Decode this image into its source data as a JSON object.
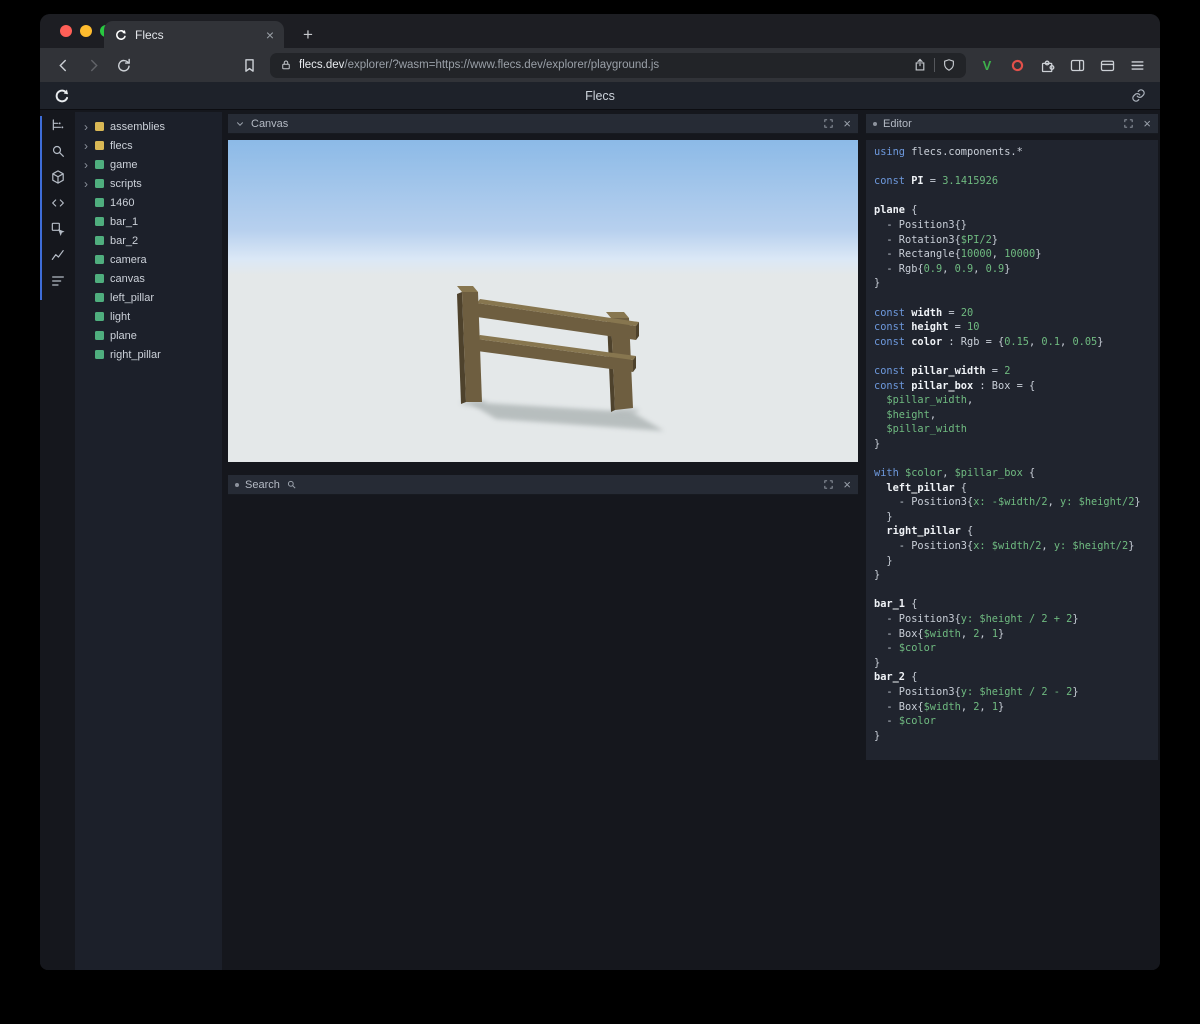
{
  "browser": {
    "tab_title": "Flecs",
    "new_tab_label": "+",
    "url_domain": "flecs.dev",
    "url_path": "/explorer/?wasm=https://www.flecs.dev/explorer/playground.js",
    "extension_v_label": "V"
  },
  "header": {
    "title": "Flecs"
  },
  "sidebar": {
    "icons": [
      "outliner-icon",
      "search-icon",
      "cube-icon",
      "code-icon",
      "inspect-icon",
      "chart-icon",
      "queries-icon"
    ],
    "accent_color": "#3e6dd8"
  },
  "tree": {
    "items": [
      {
        "label": "assemblies",
        "expandable": true,
        "color": "#d9b855"
      },
      {
        "label": "flecs",
        "expandable": true,
        "color": "#d9b855"
      },
      {
        "label": "game",
        "expandable": true,
        "color": "#4fae7e"
      },
      {
        "label": "scripts",
        "expandable": true,
        "color": "#4fae7e"
      },
      {
        "label": "1460",
        "expandable": false,
        "color": "#4fae7e"
      },
      {
        "label": "bar_1",
        "expandable": false,
        "color": "#4fae7e"
      },
      {
        "label": "bar_2",
        "expandable": false,
        "color": "#4fae7e"
      },
      {
        "label": "camera",
        "expandable": false,
        "color": "#4fae7e"
      },
      {
        "label": "canvas",
        "expandable": false,
        "color": "#4fae7e"
      },
      {
        "label": "left_pillar",
        "expandable": false,
        "color": "#4fae7e"
      },
      {
        "label": "light",
        "expandable": false,
        "color": "#4fae7e"
      },
      {
        "label": "plane",
        "expandable": false,
        "color": "#4fae7e"
      },
      {
        "label": "right_pillar",
        "expandable": false,
        "color": "#4fae7e"
      }
    ]
  },
  "panels": {
    "canvas": {
      "title": "Canvas"
    },
    "search": {
      "title": "Search"
    },
    "editor": {
      "title": "Editor"
    }
  },
  "scene": {
    "sky_top": "#8cbae7",
    "sky_mid": "#b7d0ee",
    "sky_horizon": "#dbe8f6",
    "ground": "#e4e8e9",
    "wood_front": "#6e5e40",
    "wood_top": "#87764f",
    "wood_side": "#4e422c",
    "shadow": "#a9b0b0"
  },
  "editor": {
    "lines": [
      [
        [
          "k",
          "using "
        ],
        [
          "d",
          "flecs.components.*"
        ]
      ],
      [],
      [
        [
          "k",
          "const "
        ],
        [
          "w",
          "PI"
        ],
        [
          "d",
          " = "
        ],
        [
          "g",
          "3.1415926"
        ]
      ],
      [],
      [
        [
          "w",
          "plane"
        ],
        [
          "d",
          " {"
        ]
      ],
      [
        [
          "d",
          "  - Position3{}"
        ]
      ],
      [
        [
          "d",
          "  - Rotation3{"
        ],
        [
          "g",
          "$PI/2"
        ],
        [
          "d",
          "}"
        ]
      ],
      [
        [
          "d",
          "  - Rectangle{"
        ],
        [
          "g",
          "10000"
        ],
        [
          "d",
          ", "
        ],
        [
          "g",
          "10000"
        ],
        [
          "d",
          "}"
        ]
      ],
      [
        [
          "d",
          "  - Rgb{"
        ],
        [
          "g",
          "0.9"
        ],
        [
          "d",
          ", "
        ],
        [
          "g",
          "0.9"
        ],
        [
          "d",
          ", "
        ],
        [
          "g",
          "0.9"
        ],
        [
          "d",
          "}"
        ]
      ],
      [
        [
          "d",
          "}"
        ]
      ],
      [],
      [
        [
          "k",
          "const "
        ],
        [
          "w",
          "width"
        ],
        [
          "d",
          " = "
        ],
        [
          "g",
          "20"
        ]
      ],
      [
        [
          "k",
          "const "
        ],
        [
          "w",
          "height"
        ],
        [
          "d",
          " = "
        ],
        [
          "g",
          "10"
        ]
      ],
      [
        [
          "k",
          "const "
        ],
        [
          "w",
          "color"
        ],
        [
          "d",
          " : Rgb = {"
        ],
        [
          "g",
          "0.15"
        ],
        [
          "d",
          ", "
        ],
        [
          "g",
          "0.1"
        ],
        [
          "d",
          ", "
        ],
        [
          "g",
          "0.05"
        ],
        [
          "d",
          "}"
        ]
      ],
      [],
      [
        [
          "k",
          "const "
        ],
        [
          "w",
          "pillar_width"
        ],
        [
          "d",
          " = "
        ],
        [
          "g",
          "2"
        ]
      ],
      [
        [
          "k",
          "const "
        ],
        [
          "w",
          "pillar_box"
        ],
        [
          "d",
          " : Box = {"
        ]
      ],
      [
        [
          "d",
          "  "
        ],
        [
          "g",
          "$pillar_width"
        ],
        [
          "d",
          ","
        ]
      ],
      [
        [
          "d",
          "  "
        ],
        [
          "g",
          "$height"
        ],
        [
          "d",
          ","
        ]
      ],
      [
        [
          "d",
          "  "
        ],
        [
          "g",
          "$pillar_width"
        ]
      ],
      [
        [
          "d",
          "}"
        ]
      ],
      [],
      [
        [
          "k",
          "with "
        ],
        [
          "g",
          "$color"
        ],
        [
          "d",
          ", "
        ],
        [
          "g",
          "$pillar_box"
        ],
        [
          "d",
          " {"
        ]
      ],
      [
        [
          "d",
          "  "
        ],
        [
          "w",
          "left_pillar"
        ],
        [
          "d",
          " {"
        ]
      ],
      [
        [
          "d",
          "    - Position3{"
        ],
        [
          "g",
          "x: -$width/2"
        ],
        [
          "d",
          ", "
        ],
        [
          "g",
          "y: $height/2"
        ],
        [
          "d",
          "}"
        ]
      ],
      [
        [
          "d",
          "  }"
        ]
      ],
      [
        [
          "d",
          "  "
        ],
        [
          "w",
          "right_pillar"
        ],
        [
          "d",
          " {"
        ]
      ],
      [
        [
          "d",
          "    - Position3{"
        ],
        [
          "g",
          "x: $width/2"
        ],
        [
          "d",
          ", "
        ],
        [
          "g",
          "y: $height/2"
        ],
        [
          "d",
          "}"
        ]
      ],
      [
        [
          "d",
          "  }"
        ]
      ],
      [
        [
          "d",
          "}"
        ]
      ],
      [],
      [
        [
          "w",
          "bar_1"
        ],
        [
          "d",
          " {"
        ]
      ],
      [
        [
          "d",
          "  - Position3{"
        ],
        [
          "g",
          "y: $height / 2 + 2"
        ],
        [
          "d",
          "}"
        ]
      ],
      [
        [
          "d",
          "  - Box{"
        ],
        [
          "g",
          "$width"
        ],
        [
          "d",
          ", "
        ],
        [
          "g",
          "2"
        ],
        [
          "d",
          ", "
        ],
        [
          "g",
          "1"
        ],
        [
          "d",
          "}"
        ]
      ],
      [
        [
          "d",
          "  - "
        ],
        [
          "g",
          "$color"
        ]
      ],
      [
        [
          "d",
          "}"
        ]
      ],
      [
        [
          "w",
          "bar_2"
        ],
        [
          "d",
          " {"
        ]
      ],
      [
        [
          "d",
          "  - Position3{"
        ],
        [
          "g",
          "y: $height / 2 - 2"
        ],
        [
          "d",
          "}"
        ]
      ],
      [
        [
          "d",
          "  - Box{"
        ],
        [
          "g",
          "$width"
        ],
        [
          "d",
          ", "
        ],
        [
          "g",
          "2"
        ],
        [
          "d",
          ", "
        ],
        [
          "g",
          "1"
        ],
        [
          "d",
          "}"
        ]
      ],
      [
        [
          "d",
          "  - "
        ],
        [
          "g",
          "$color"
        ]
      ],
      [
        [
          "d",
          "}"
        ]
      ]
    ]
  }
}
